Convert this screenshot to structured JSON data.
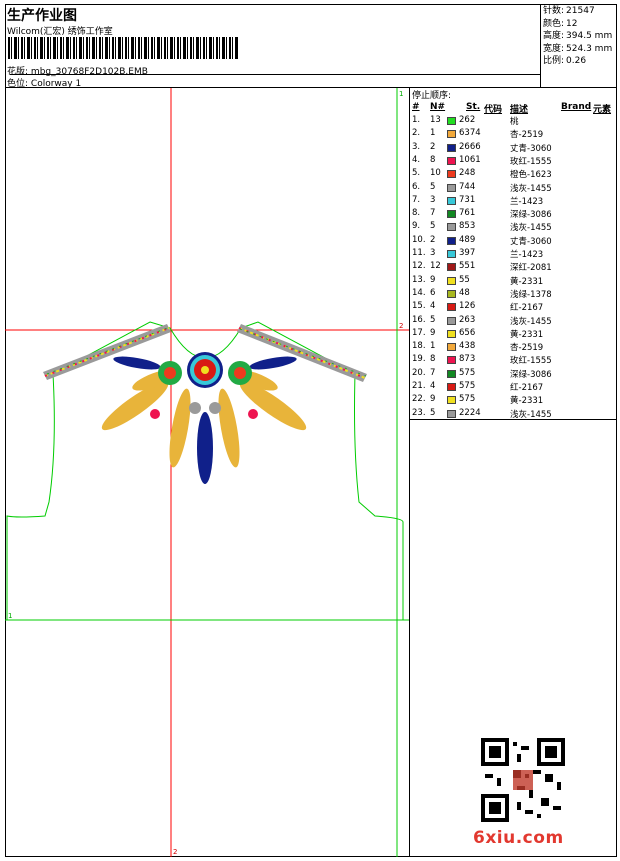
{
  "header": {
    "title": "生产作业图",
    "company": "Wilcom(汇宏) 绣饰工作室",
    "design_name_label": "花版:",
    "design_name": "mbg_30768F2D102B.EMB",
    "colorway_label": "色位:",
    "colorway": "Colorway 1"
  },
  "stats": [
    {
      "label": "针数:",
      "value": "21547"
    },
    {
      "label": "颜色:",
      "value": "12"
    },
    {
      "label": "高度:",
      "value": "394.5 mm"
    },
    {
      "label": "宽度:",
      "value": "524.3 mm"
    },
    {
      "label": "比例:",
      "value": "0.26"
    }
  ],
  "stop_sequence": {
    "title": "停止顺序:",
    "columns": [
      "#",
      "N#",
      "St.",
      "代码",
      "描述",
      "Brand",
      "元素"
    ],
    "rows": [
      {
        "idx": "1.",
        "n": "13",
        "color": "#22dd22",
        "st": "262",
        "desc": "桃"
      },
      {
        "idx": "2.",
        "n": "1",
        "color": "#f2a93b",
        "st": "6374",
        "desc": "杏-2519"
      },
      {
        "idx": "3.",
        "n": "2",
        "color": "#10208a",
        "st": "2666",
        "desc": "丈青-3060"
      },
      {
        "idx": "4.",
        "n": "8",
        "color": "#ee1450",
        "st": "1061",
        "desc": "玫红-1555"
      },
      {
        "idx": "5.",
        "n": "10",
        "color": "#ee3a1e",
        "st": "248",
        "desc": "橙色-1623"
      },
      {
        "idx": "6.",
        "n": "5",
        "color": "#9a9a9a",
        "st": "744",
        "desc": "浅灰-1455"
      },
      {
        "idx": "7.",
        "n": "3",
        "color": "#38c8d8",
        "st": "731",
        "desc": "兰-1423"
      },
      {
        "idx": "8.",
        "n": "7",
        "color": "#118822",
        "st": "761",
        "desc": "深绿-3086"
      },
      {
        "idx": "9.",
        "n": "5",
        "color": "#9a9a9a",
        "st": "853",
        "desc": "浅灰-1455"
      },
      {
        "idx": "10.",
        "n": "2",
        "color": "#10208a",
        "st": "489",
        "desc": "丈青-3060"
      },
      {
        "idx": "11.",
        "n": "3",
        "color": "#38c8d8",
        "st": "397",
        "desc": "兰-1423"
      },
      {
        "idx": "12.",
        "n": "12",
        "color": "#a01818",
        "st": "551",
        "desc": "深红-2081"
      },
      {
        "idx": "13.",
        "n": "9",
        "color": "#f0e020",
        "st": "55",
        "desc": "黄-2331"
      },
      {
        "idx": "14.",
        "n": "6",
        "color": "#a8b820",
        "st": "48",
        "desc": "浅绿-1378"
      },
      {
        "idx": "15.",
        "n": "4",
        "color": "#d81a14",
        "st": "126",
        "desc": "红-2167"
      },
      {
        "idx": "16.",
        "n": "5",
        "color": "#9a9a9a",
        "st": "263",
        "desc": "浅灰-1455"
      },
      {
        "idx": "17.",
        "n": "9",
        "color": "#f0e020",
        "st": "656",
        "desc": "黄-2331"
      },
      {
        "idx": "18.",
        "n": "1",
        "color": "#f2a93b",
        "st": "438",
        "desc": "杏-2519"
      },
      {
        "idx": "19.",
        "n": "8",
        "color": "#ee1450",
        "st": "873",
        "desc": "玫红-1555"
      },
      {
        "idx": "20.",
        "n": "7",
        "color": "#118822",
        "st": "575",
        "desc": "深绿-3086"
      },
      {
        "idx": "21.",
        "n": "4",
        "color": "#d81a14",
        "st": "575",
        "desc": "红-2167"
      },
      {
        "idx": "22.",
        "n": "9",
        "color": "#f0e020",
        "st": "575",
        "desc": "黄-2331"
      },
      {
        "idx": "23.",
        "n": "5",
        "color": "#9a9a9a",
        "st": "2224",
        "desc": "浅灰-1455"
      }
    ]
  },
  "canvas_markers": {
    "m1": "1",
    "m2": "2",
    "m3": "1",
    "m4": "2"
  },
  "watermark": "6xiu.com",
  "colors": {
    "guide_red": "#ff0000",
    "outline_green": "#00cc00",
    "border": "#000000"
  }
}
